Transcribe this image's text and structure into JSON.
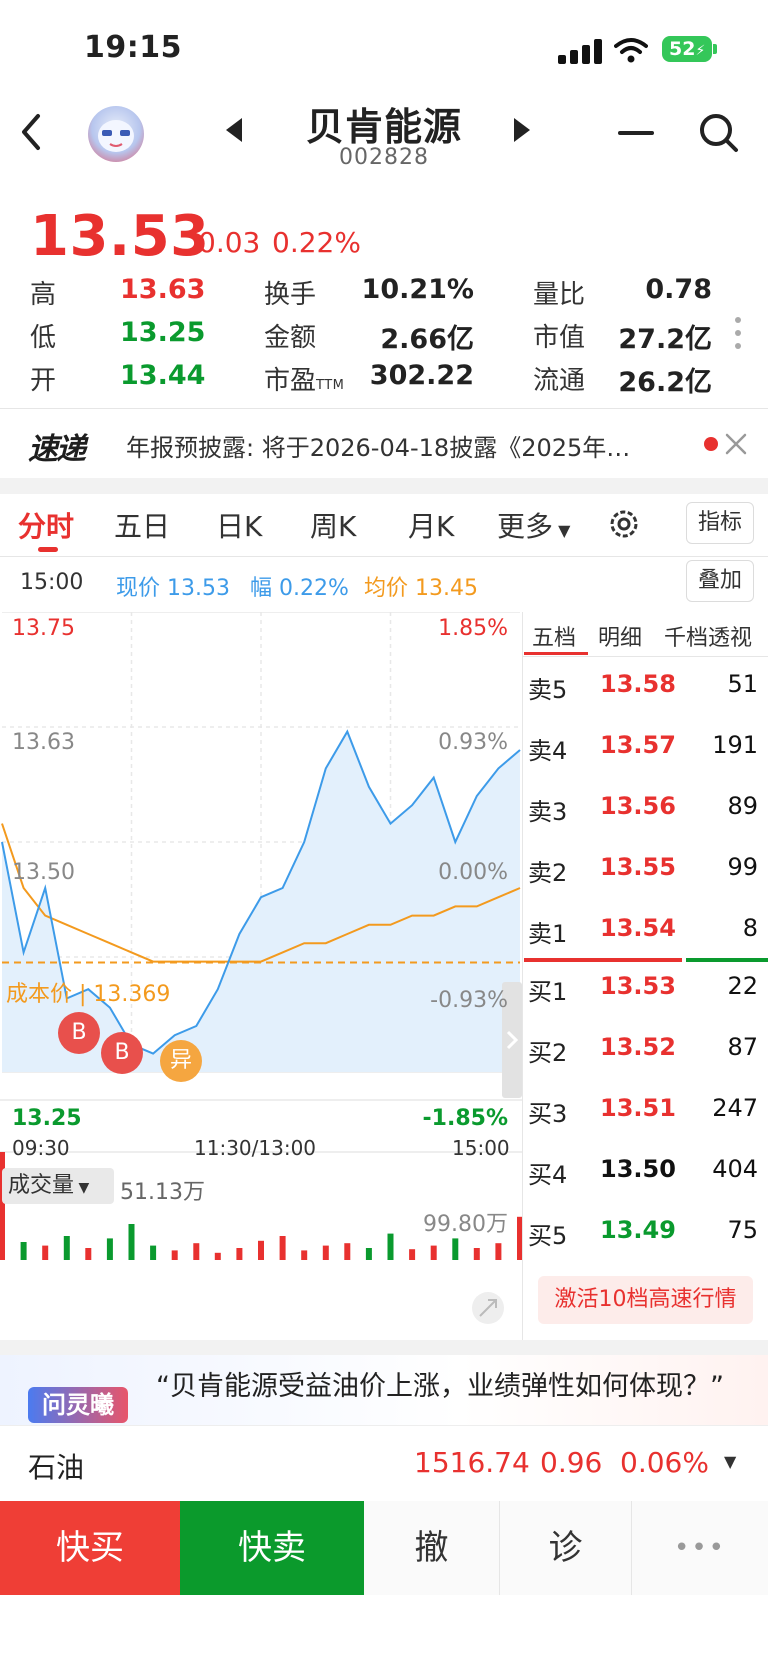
{
  "status_bar": {
    "time": "19:15",
    "battery": "52"
  },
  "header": {
    "stock_name": "贝肯能源",
    "stock_code": "002828"
  },
  "quote": {
    "price": "13.53",
    "change": "0.03",
    "change_pct": "0.22%",
    "high_label": "高",
    "high": "13.63",
    "low_label": "低",
    "low": "13.25",
    "open_label": "开",
    "open": "13.44",
    "turnover_label": "换手",
    "turnover": "10.21%",
    "amount_label": "金额",
    "amount": "2.66亿",
    "pe_label": "市盈",
    "pe_suffix": "TTM",
    "pe": "302.22",
    "vol_ratio_label": "量比",
    "vol_ratio": "0.78",
    "mkt_cap_label": "市值",
    "mkt_cap": "27.2亿",
    "float_cap_label": "流通",
    "float_cap": "26.2亿"
  },
  "news": {
    "logo": "速递",
    "text": "年报预披露: 将于2026-04-18披露《2025年…"
  },
  "tabs": [
    "分时",
    "五日",
    "日K",
    "周K",
    "月K",
    "更多"
  ],
  "indicator_button": "指标",
  "overlay_button": "叠加",
  "info_row": {
    "time": "15:00",
    "current": "现价 13.53",
    "amp": "幅 0.22%",
    "avg": "均价 13.45"
  },
  "chart_labels": {
    "y_top": "13.75",
    "y_top_pct": "1.85%",
    "y_mid1": "13.63",
    "y_mid1_pct": "0.93%",
    "y_mid2": "13.50",
    "y_mid2_pct": "0.00%",
    "y_mid3_pct": "-0.93%",
    "y_bottom": "13.25",
    "y_bottom_pct": "-1.85%",
    "cost_label": "成本价 | 13.369",
    "buy_marker": "B",
    "anomaly_marker": "异",
    "x_start": "09:30",
    "x_mid": "11:30/13:00",
    "x_end": "15:00",
    "volume_selector": "成交量",
    "volume_value": "51.13万",
    "volume_max": "99.80万"
  },
  "chart_data": {
    "type": "line",
    "title": "",
    "xlabel": "",
    "ylabel": "",
    "ylim": [
      13.25,
      13.75
    ],
    "x": [
      0,
      10,
      20,
      30,
      40,
      50,
      60,
      70,
      80,
      90,
      100,
      110,
      120,
      130,
      140,
      150,
      160,
      170,
      180,
      190,
      200,
      210,
      220,
      230,
      240
    ],
    "series": [
      {
        "values": [
          13.5,
          13.38,
          13.45,
          13.33,
          13.34,
          13.32,
          13.28,
          13.27,
          13.29,
          13.3,
          13.34,
          13.4,
          13.44,
          13.45,
          13.5,
          13.58,
          13.62,
          13.56,
          13.52,
          13.54,
          13.57,
          13.5,
          13.55,
          13.58,
          13.6
        ]
      },
      {
        "values": [
          13.52,
          13.45,
          13.42,
          13.41,
          13.4,
          13.39,
          13.38,
          13.37,
          13.37,
          13.37,
          13.37,
          13.37,
          13.37,
          13.38,
          13.39,
          13.39,
          13.4,
          13.41,
          13.41,
          13.42,
          13.42,
          13.43,
          13.43,
          13.44,
          13.45
        ]
      }
    ],
    "reference": 13.5,
    "cost_price": 13.369,
    "volume": [
      0.9,
      0.15,
      0.12,
      0.2,
      0.1,
      0.18,
      0.3,
      0.12,
      0.08,
      0.14,
      0.06,
      0.1,
      0.16,
      0.2,
      0.08,
      0.12,
      0.14,
      0.1,
      0.22,
      0.09,
      0.12,
      0.18,
      0.1,
      0.14,
      0.36
    ]
  },
  "order_book": {
    "tabs": [
      "五档",
      "明细",
      "千档透视"
    ],
    "asks": [
      {
        "label": "卖5",
        "price": "13.58",
        "vol": "51"
      },
      {
        "label": "卖4",
        "price": "13.57",
        "vol": "191"
      },
      {
        "label": "卖3",
        "price": "13.56",
        "vol": "89"
      },
      {
        "label": "卖2",
        "price": "13.55",
        "vol": "99"
      },
      {
        "label": "卖1",
        "price": "13.54",
        "vol": "8"
      }
    ],
    "bids": [
      {
        "label": "买1",
        "price": "13.53",
        "vol": "22"
      },
      {
        "label": "买2",
        "price": "13.52",
        "vol": "87"
      },
      {
        "label": "买3",
        "price": "13.51",
        "vol": "247"
      },
      {
        "label": "买4",
        "price": "13.50",
        "vol": "404"
      },
      {
        "label": "买5",
        "price": "13.49",
        "vol": "75"
      }
    ],
    "activate": "激活10档高速行情"
  },
  "ai_banner": {
    "tag": "问灵曦",
    "text": "“贝肯能源受益油价上涨，业绩弹性如何体现？”"
  },
  "oil": {
    "name": "石油",
    "price": "1516.74",
    "change": "0.96",
    "change_pct": "0.06%"
  },
  "actions": {
    "buy": "快买",
    "sell": "快卖",
    "cancel": "撤",
    "diagnose": "诊",
    "more": "•••"
  },
  "colors": {
    "up": "#e8312f",
    "down": "#0a9a2e",
    "price_line": "#3d9be9",
    "avg_line": "#f39a1e"
  }
}
